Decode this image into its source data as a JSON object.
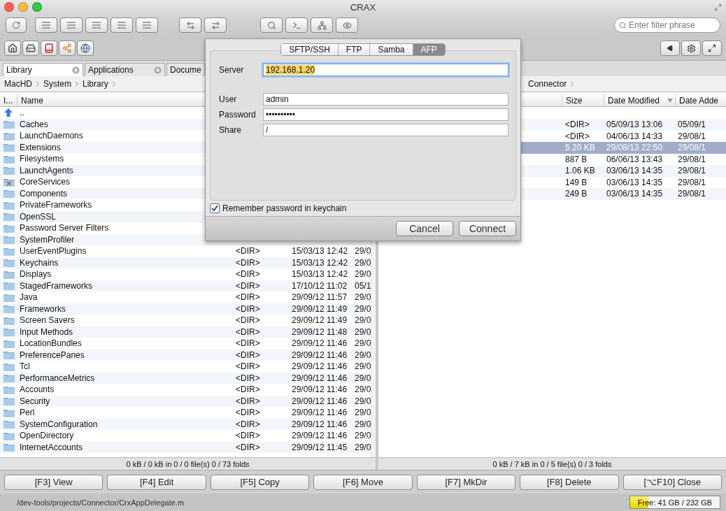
{
  "window": {
    "title": "CRAX"
  },
  "toolbar": {
    "filter": {
      "placeholder": "Enter filter phrase"
    }
  },
  "left_panel": {
    "tabs": [
      {
        "label": "Library",
        "selected": true
      },
      {
        "label": "Applications",
        "selected": false
      },
      {
        "label": "Docume",
        "selected": false
      }
    ],
    "breadcrumb": [
      "MacHD",
      "System",
      "Library"
    ],
    "columns": [
      "I...",
      "Name"
    ],
    "rows": [
      {
        "kind": "up",
        "name": ".."
      },
      {
        "kind": "folder",
        "name": "Caches"
      },
      {
        "kind": "folder",
        "name": "LaunchDaemons"
      },
      {
        "kind": "folder",
        "name": "Extensions"
      },
      {
        "kind": "folder",
        "name": "Filesystems"
      },
      {
        "kind": "folder",
        "name": "LaunchAgents"
      },
      {
        "kind": "alias-folder",
        "name": "CoreServices"
      },
      {
        "kind": "folder",
        "name": "Components"
      },
      {
        "kind": "folder",
        "name": "PrivateFrameworks"
      },
      {
        "kind": "folder",
        "name": "OpenSSL"
      },
      {
        "kind": "folder",
        "name": "Password Server Filters"
      },
      {
        "kind": "folder",
        "name": "SystemProfiler"
      },
      {
        "kind": "folder",
        "name": "UserEventPlugins",
        "size": "<DIR>",
        "modified": "15/03/13 12:42",
        "added": "29/0"
      },
      {
        "kind": "folder",
        "name": "Keychains",
        "size": "<DIR>",
        "modified": "15/03/13 12:42",
        "added": "29/0"
      },
      {
        "kind": "folder",
        "name": "Displays",
        "size": "<DIR>",
        "modified": "15/03/13 12:42",
        "added": "29/0"
      },
      {
        "kind": "folder",
        "name": "StagedFrameworks",
        "size": "<DIR>",
        "modified": "17/10/12 11:02",
        "added": "05/1"
      },
      {
        "kind": "folder",
        "name": "Java",
        "size": "<DIR>",
        "modified": "29/09/12 11:57",
        "added": "29/0"
      },
      {
        "kind": "folder",
        "name": "Frameworks",
        "size": "<DIR>",
        "modified": "29/09/12 11:49",
        "added": "29/0"
      },
      {
        "kind": "folder",
        "name": "Screen Savers",
        "size": "<DIR>",
        "modified": "29/09/12 11:49",
        "added": "29/0"
      },
      {
        "kind": "folder",
        "name": "Input Methods",
        "size": "<DIR>",
        "modified": "29/09/12 11:48",
        "added": "29/0"
      },
      {
        "kind": "folder",
        "name": "LocationBundles",
        "size": "<DIR>",
        "modified": "29/09/12 11:46",
        "added": "29/0"
      },
      {
        "kind": "folder",
        "name": "PreferencePanes",
        "size": "<DIR>",
        "modified": "29/09/12 11:46",
        "added": "29/0"
      },
      {
        "kind": "folder",
        "name": "Tcl",
        "size": "<DIR>",
        "modified": "29/09/12 11:46",
        "added": "29/0"
      },
      {
        "kind": "folder",
        "name": "PerformanceMetrics",
        "size": "<DIR>",
        "modified": "29/09/12 11:46",
        "added": "29/0"
      },
      {
        "kind": "folder",
        "name": "Accounts",
        "size": "<DIR>",
        "modified": "29/09/12 11:46",
        "added": "29/0"
      },
      {
        "kind": "folder",
        "name": "Security",
        "size": "<DIR>",
        "modified": "29/09/12 11:46",
        "added": "29/0"
      },
      {
        "kind": "folder",
        "name": "Perl",
        "size": "<DIR>",
        "modified": "29/09/12 11:46",
        "added": "29/0"
      },
      {
        "kind": "folder",
        "name": "SystemConfiguration",
        "size": "<DIR>",
        "modified": "29/09/12 11:46",
        "added": "29/0"
      },
      {
        "kind": "folder",
        "name": "OpenDirectory",
        "size": "<DIR>",
        "modified": "29/09/12 11:46",
        "added": "29/0"
      },
      {
        "kind": "folder",
        "name": "InternetAccounts",
        "size": "<DIR>",
        "modified": "29/09/12 11:45",
        "added": "29/0"
      }
    ],
    "status": "0 kB / 0 kB in 0 / 0 file(s) 0 / 73 folds"
  },
  "right_panel": {
    "breadcrumb": [
      "Connector"
    ],
    "columns": [
      {
        "label": "Size",
        "sorted": false
      },
      {
        "label": "Date Modified",
        "sorted": true
      },
      {
        "label": "Date Adde",
        "sorted": false
      }
    ],
    "rows": [
      {
        "size": "<DIR>",
        "modified": "05/09/13 13:06",
        "added": "05/09/1",
        "selected": false
      },
      {
        "size": "<DIR>",
        "modified": "04/06/13 14:33",
        "added": "29/08/1",
        "selected": false
      },
      {
        "size": "5.20 KB",
        "modified": "29/08/13 22:50",
        "added": "29/08/1",
        "selected": true
      },
      {
        "size": "887 B",
        "modified": "06/06/13 13:43",
        "added": "29/08/1",
        "selected": false
      },
      {
        "size": "1.06 KB",
        "modified": "03/06/13 14:35",
        "added": "29/08/1",
        "selected": false
      },
      {
        "size": "149 B",
        "modified": "03/06/13 14:35",
        "added": "29/08/1",
        "selected": false
      },
      {
        "size": "249 B",
        "modified": "03/06/13 14:35",
        "added": "29/08/1",
        "selected": false
      }
    ],
    "status": "0 kB / 7 kB in 0 / 5 file(s) 0 / 3 folds"
  },
  "function_keys": [
    "[F3] View",
    "[F4] Edit",
    "[F5] Copy",
    "[F6] Move",
    "[F7] MkDir",
    "[F8] Delete",
    "[⌥F10] Close"
  ],
  "path": "/dev-tools/projects/Connector/CrxAppDelegate.m",
  "disk": {
    "label": "Free: 41 GB / 232 GB",
    "level": 0.2
  },
  "dialog": {
    "tabs": [
      {
        "label": "SFTP/SSH",
        "selected": false
      },
      {
        "label": "FTP",
        "selected": false
      },
      {
        "label": "Samba",
        "selected": false
      },
      {
        "label": "AFP",
        "selected": true
      }
    ],
    "fields": [
      {
        "label": "Server",
        "value": "192.168.1.20",
        "focused": true
      },
      {
        "label": "User",
        "value": "admin",
        "focused": false
      },
      {
        "label": "Password",
        "value": "••••••••••",
        "focused": false
      },
      {
        "label": "Share",
        "value": "/",
        "focused": false
      }
    ],
    "remember": {
      "label": "Remember password in keychain",
      "checked": true
    },
    "buttons": [
      "Cancel",
      "Connect"
    ]
  }
}
